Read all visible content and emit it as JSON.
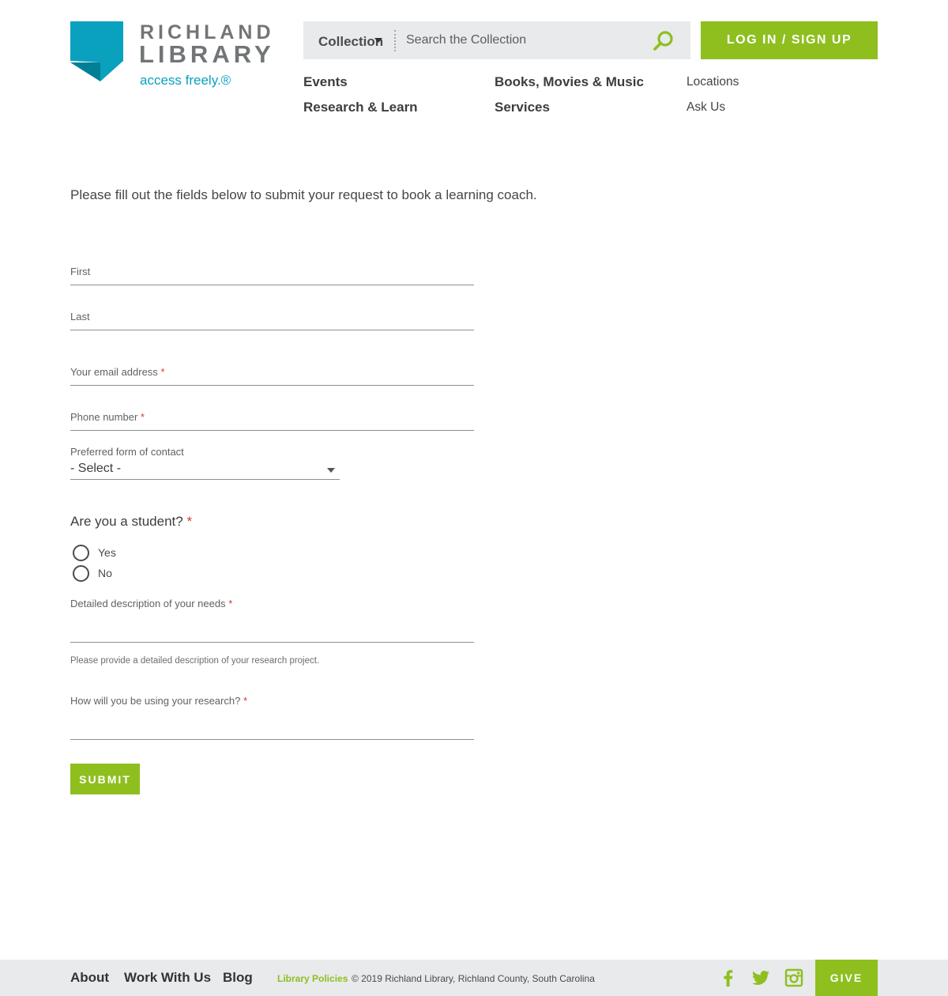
{
  "header": {
    "logo": {
      "line1": "RICHLAND",
      "line2": "LIBRARY",
      "tagline": "access freely.®"
    },
    "search": {
      "scope": "Collection",
      "placeholder": "Search the Collection"
    },
    "login_label": "LOG IN / SIGN UP",
    "nav": {
      "events": "Events",
      "research": "Research & Learn",
      "books": "Books, Movies & Music",
      "services": "Services",
      "locations": "Locations",
      "ask": "Ask Us"
    }
  },
  "form": {
    "intro": "Please fill out the fields below to submit your request to book a learning coach.",
    "first_label": "First",
    "last_label": "Last",
    "email_label": "Your email address",
    "phone_label": "Phone number",
    "required_mark": "*",
    "contact_label": "Preferred form of contact",
    "contact_selected": "- Select -",
    "student_question": "Are you a student?",
    "student_options": [
      "Yes",
      "No"
    ],
    "needs_label": "Detailed description of your needs",
    "needs_help": "Please provide a detailed description of your research project.",
    "usage_label": "How will you be using your research?",
    "submit_label": "SUBMIT"
  },
  "footer": {
    "about": "About",
    "work": "Work With Us",
    "blog": "Blog",
    "policies": "Library Policies",
    "copyright": "© 2019 Richland Library, Richland County, South Carolina",
    "give": "GIVE"
  },
  "colors": {
    "brand_green": "#8ebf1f",
    "brand_teal": "#0aa1bf",
    "required_red": "#d83a2e"
  }
}
